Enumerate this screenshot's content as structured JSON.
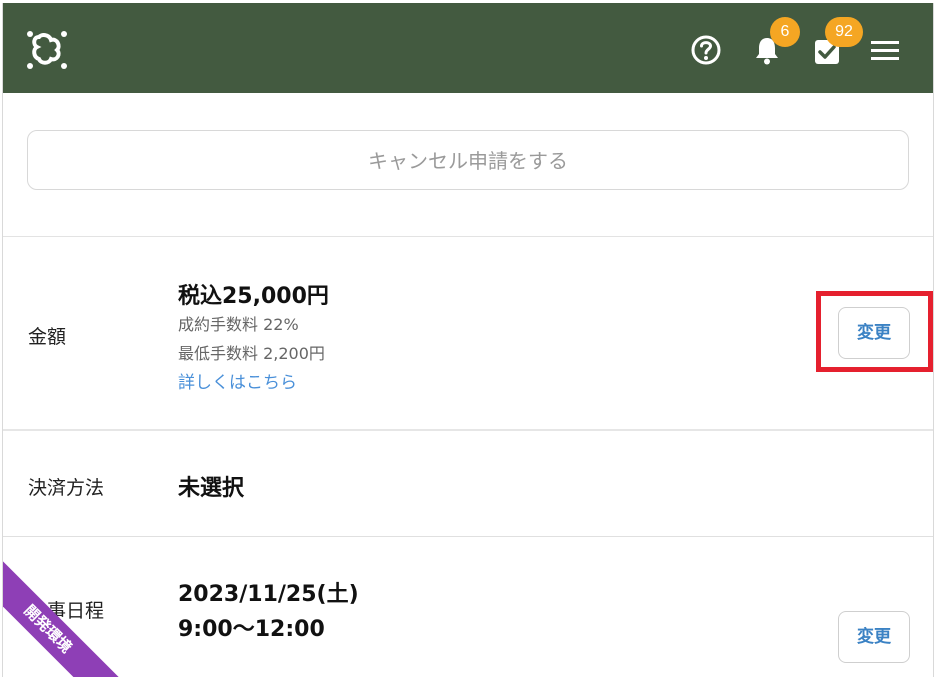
{
  "header": {
    "logo_icon": "clover-logo-icon",
    "help_icon": "help-circle-icon",
    "notifications": {
      "icon": "bell-icon",
      "count": "6"
    },
    "tasks": {
      "icon": "task-check-icon",
      "count": "92"
    },
    "menu_icon": "hamburger-menu-icon",
    "bg_color": "#435a40",
    "badge_color": "#f5a623"
  },
  "cancel": {
    "label": "キャンセル申請をする"
  },
  "amount": {
    "label": "金額",
    "value": "税込25,000円",
    "fee": "成約手数料 22%",
    "min_fee": "最低手数料 2,200円",
    "details_link": "詳しくはこちら",
    "change_label": "変更"
  },
  "payment": {
    "label": "決済方法",
    "value": "未選択"
  },
  "schedule": {
    "label": "仕事日程",
    "date": "2023/11/25(土)",
    "time": "9:00〜12:00",
    "change_label": "変更"
  },
  "env_ribbon": {
    "label": "開発環境",
    "color": "#8e3fb6"
  },
  "highlight_color": "#e5202e"
}
